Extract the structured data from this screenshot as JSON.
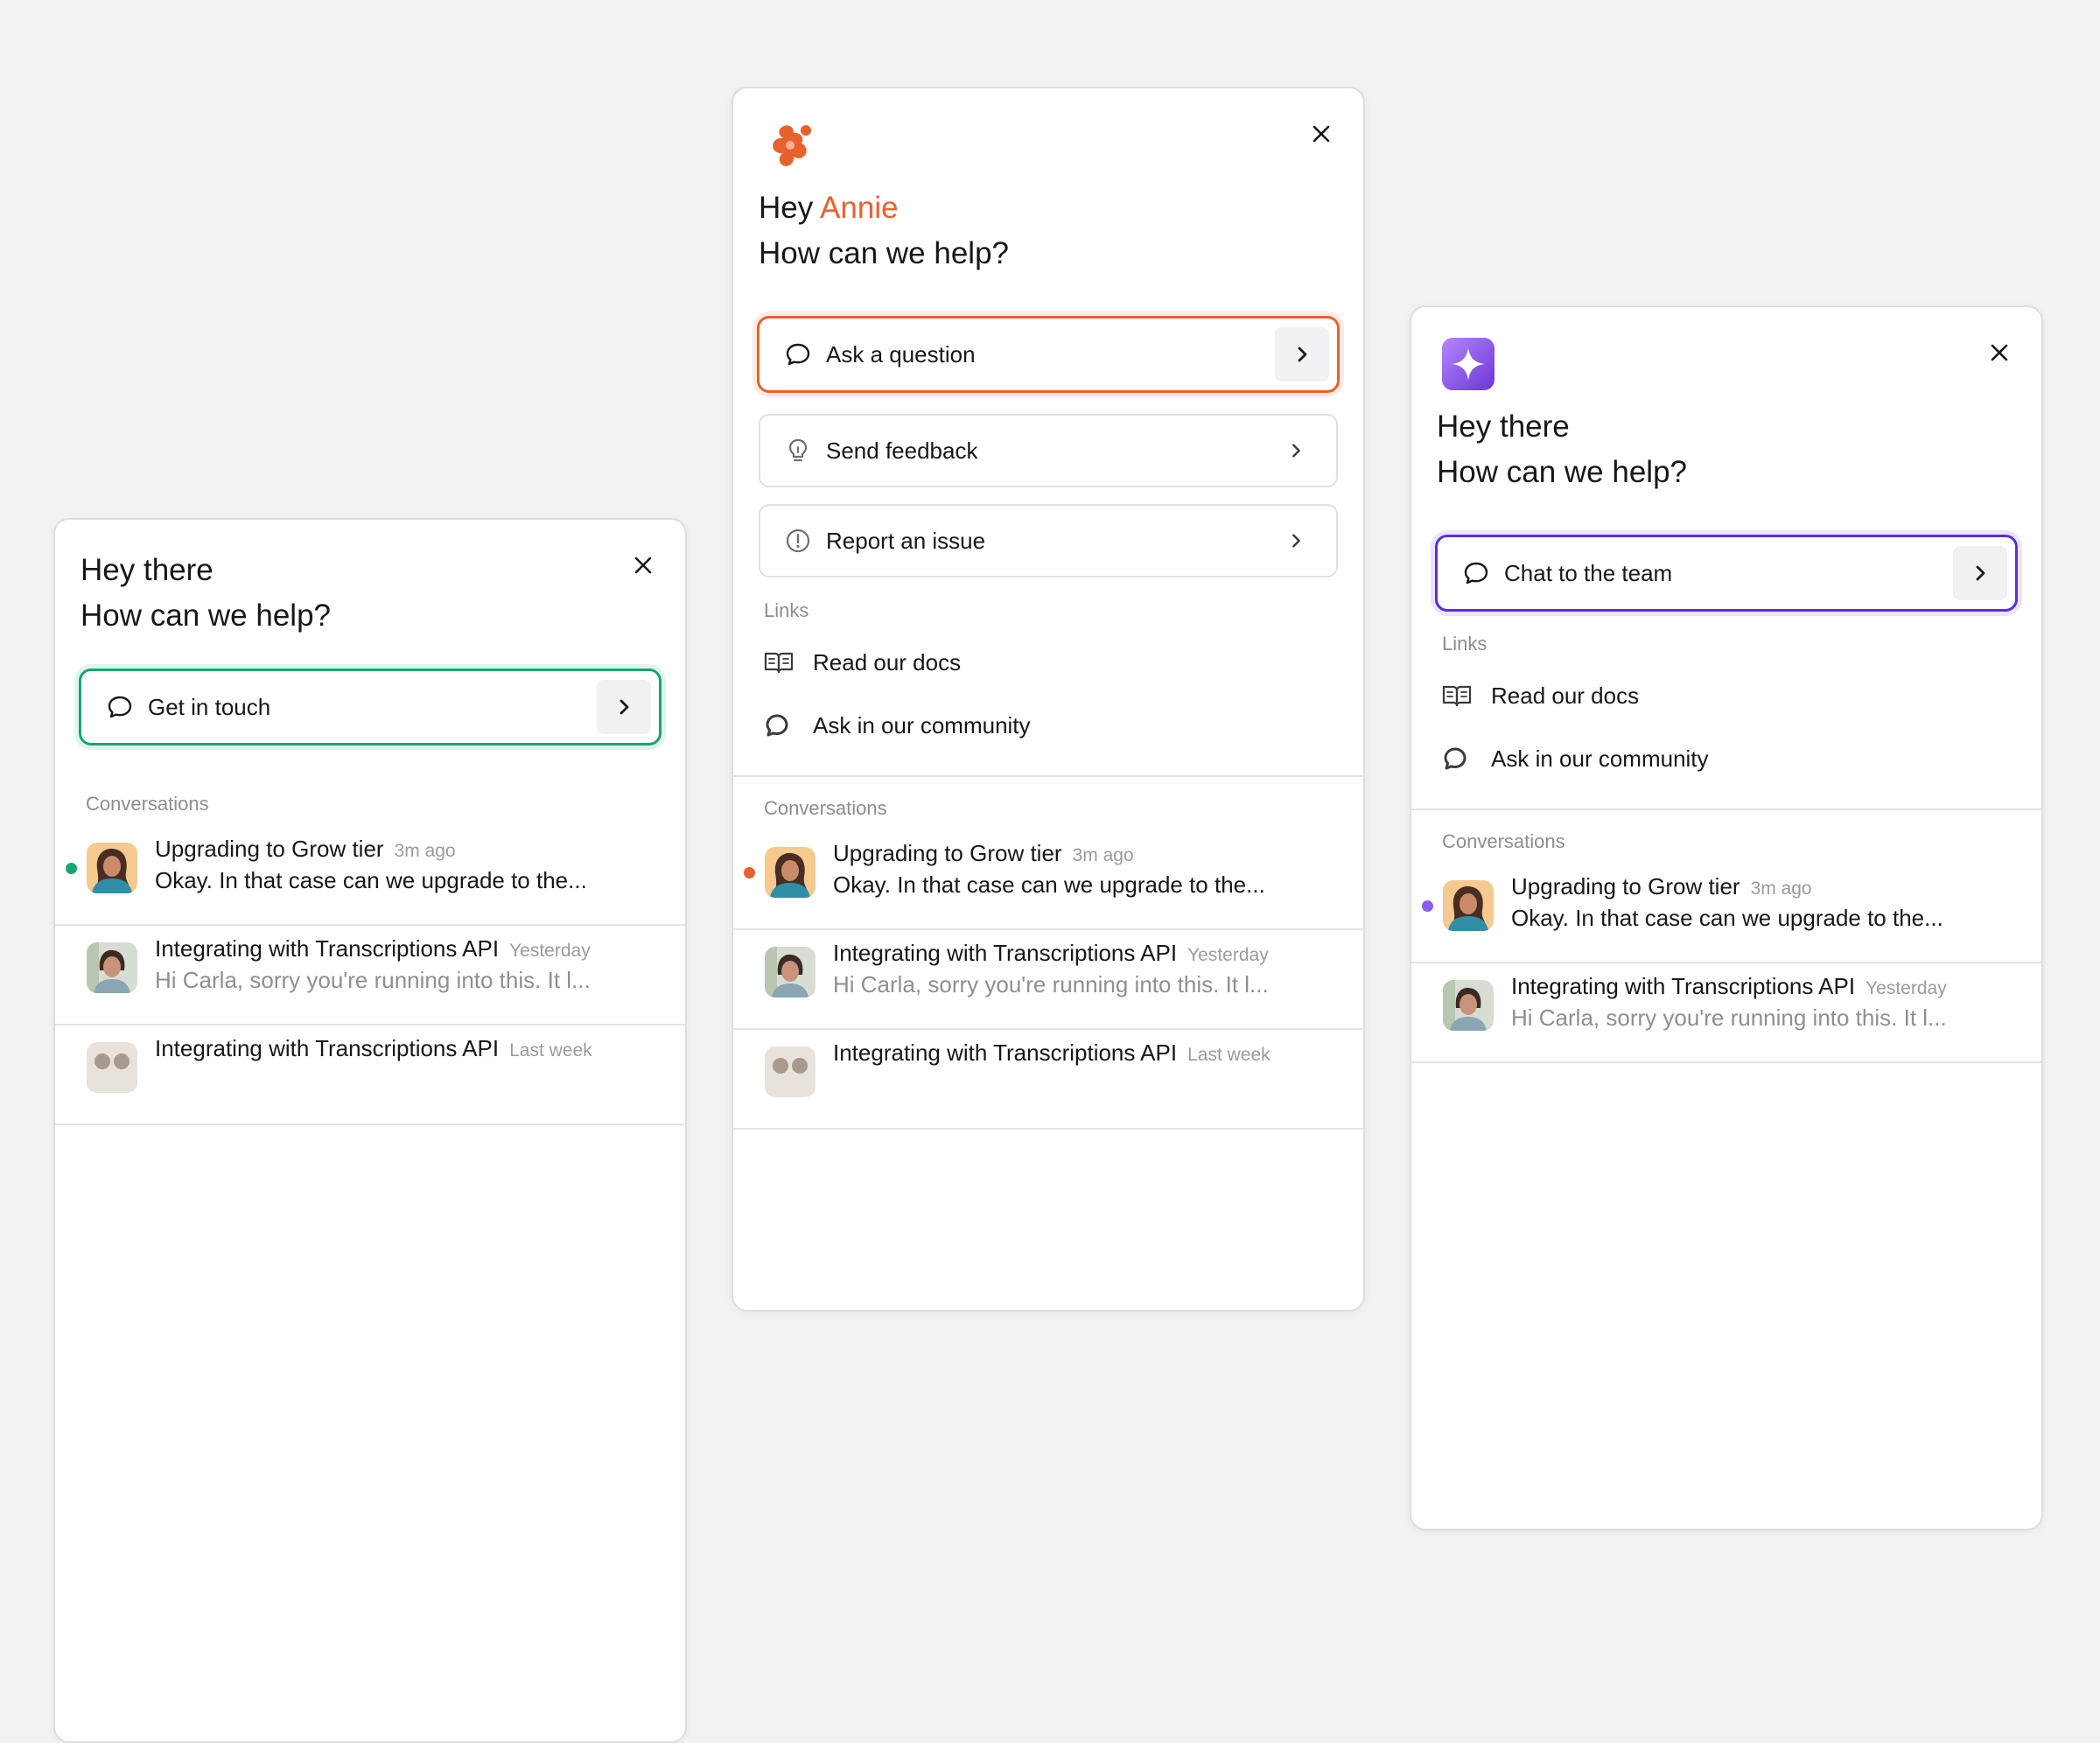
{
  "colors": {
    "green": "#16a676",
    "orange": "#e8612c",
    "purple": "#5b2ce0",
    "dot_purple": "#8d5cf0"
  },
  "icons": {
    "close": "close-icon",
    "chat": "chat-bubble-icon",
    "arrow": "chevron-right-icon",
    "feedback": "lightbulb-icon",
    "issue": "alert-circle-icon",
    "docs": "book-open-icon",
    "community": "community-bubble-icon"
  },
  "widgets": [
    {
      "greeting_line1": "Hey there",
      "greeting_line2": "How can we help?",
      "primary_action": "Get in touch",
      "conversations_label": "Conversations",
      "conversations": [
        {
          "title": "Upgrading to Grow tier",
          "time": "3m ago",
          "preview": "Okay. In that case can we upgrade to the...",
          "unread": true
        },
        {
          "title": "Integrating with Transcriptions API",
          "time": "Yesterday",
          "preview": "Hi Carla, sorry you're running into this. It l...",
          "unread": false
        },
        {
          "title": "Integrating with Transcriptions API",
          "time": "Last week",
          "preview": "",
          "unread": false
        }
      ]
    },
    {
      "greeting_hey": "Hey",
      "greeting_name": "Annie",
      "greeting_line2": "How can we help?",
      "primary_action": "Ask a question",
      "secondary_actions": [
        "Send feedback",
        "Report an issue"
      ],
      "links_label": "Links",
      "links": [
        "Read our docs",
        "Ask in our community"
      ],
      "conversations_label": "Conversations",
      "conversations": [
        {
          "title": "Upgrading to Grow tier",
          "time": "3m ago",
          "preview": "Okay. In that case can we upgrade to the...",
          "unread": true
        },
        {
          "title": "Integrating with Transcriptions API",
          "time": "Yesterday",
          "preview": "Hi Carla, sorry you're running into this. It l...",
          "unread": false
        },
        {
          "title": "Integrating with Transcriptions API",
          "time": "Last week",
          "preview": "",
          "unread": false
        }
      ]
    },
    {
      "greeting_line1": "Hey there",
      "greeting_line2": "How can we help?",
      "primary_action": "Chat to the team",
      "links_label": "Links",
      "links": [
        "Read our docs",
        "Ask in our community"
      ],
      "conversations_label": "Conversations",
      "conversations": [
        {
          "title": "Upgrading to Grow tier",
          "time": "3m ago",
          "preview": "Okay. In that case can we upgrade to the...",
          "unread": true
        },
        {
          "title": "Integrating with Transcriptions API",
          "time": "Yesterday",
          "preview": "Hi Carla, sorry you're running into this. It l...",
          "unread": false
        }
      ]
    }
  ]
}
